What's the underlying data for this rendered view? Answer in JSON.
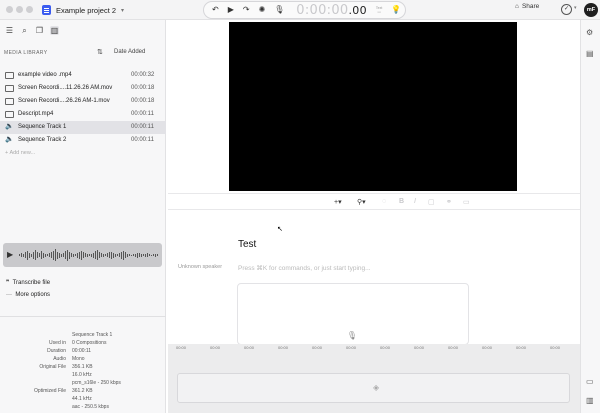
{
  "window": {
    "project_title": "Example project 2"
  },
  "transport": {
    "timecode_dim": "0:00:00",
    "timecode_bright": ".00",
    "tiny_label": "Text"
  },
  "header": {
    "share_label": "Share",
    "avatar_initials": "mF"
  },
  "library": {
    "title": "MEDIA LIBRARY",
    "sort_label": "Date Added",
    "items": [
      {
        "name": "example video .mp4",
        "duration": "00:00:32",
        "type": "video"
      },
      {
        "name": "Screen Recordi....11.26.26 AM.mov",
        "duration": "00:00:18",
        "type": "video"
      },
      {
        "name": "Screen Recordi....26.26 AM-1.mov",
        "duration": "00:00:18",
        "type": "video"
      },
      {
        "name": "Descript.mp4",
        "duration": "00:00:11",
        "type": "video"
      },
      {
        "name": "Sequence Track 1",
        "duration": "00:00:11",
        "type": "audio",
        "selected": true
      },
      {
        "name": "Sequence Track 2",
        "duration": "00:00:11",
        "type": "audio"
      }
    ],
    "add_new": "Add new..."
  },
  "actions": {
    "transcribe": "Transcribe file",
    "more_options": "More options"
  },
  "metadata": {
    "title": "Sequence Track 1",
    "used_in_key": "Used in",
    "used_in_val": "0 Compositions",
    "duration_key": "Duration",
    "duration_val": "00:00:11",
    "audio_key": "Audio",
    "audio_val": "Mono",
    "original_key": "Original File",
    "original_size": "356.1 KB",
    "original_rate": "16.0 kHz",
    "original_codec": "pcm_s16le - 250 kbps",
    "optimized_key": "Optimized File",
    "optimized_size": "361.2 KB",
    "optimized_rate": "44.1 kHz",
    "optimized_codec": "aac - 250.5 kbps"
  },
  "editor": {
    "doc_title": "Test",
    "speaker": "Unknown speaker",
    "prompt": "Press ⌘K for commands, or just start typing..."
  },
  "timeline": {
    "tick_label": "00:00"
  }
}
